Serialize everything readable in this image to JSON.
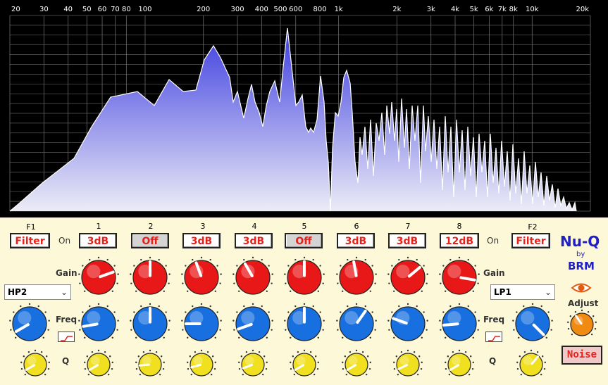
{
  "spectrum": {
    "freq_labels": [
      "20",
      "30",
      "40",
      "50",
      "60",
      "70",
      "80",
      "100",
      "200",
      "300",
      "400",
      "500",
      "600",
      "800",
      "1k",
      "2k",
      "3k",
      "4k",
      "5k",
      "6k",
      "7k",
      "8k",
      "10k",
      "20k"
    ],
    "background": "#000000",
    "fill_top": "#4b4be8",
    "fill_bottom": "#e6e6f5",
    "line": "#ffffff"
  },
  "filters": {
    "f1_label": "F1",
    "f2_label": "F2",
    "f1_button": "Filter",
    "f2_button": "Filter",
    "on_left": "On",
    "on_right": "On",
    "f1_type": "HP2",
    "f2_type": "LP1"
  },
  "bands": [
    {
      "number": "1",
      "button": "3dB",
      "off": false
    },
    {
      "number": "2",
      "button": "Off",
      "off": true
    },
    {
      "number": "3",
      "button": "3dB",
      "off": false
    },
    {
      "number": "4",
      "button": "3dB",
      "off": false
    },
    {
      "number": "5",
      "button": "Off",
      "off": true
    },
    {
      "number": "6",
      "button": "3dB",
      "off": false
    },
    {
      "number": "7",
      "button": "3dB",
      "off": false
    },
    {
      "number": "8",
      "button": "12dB",
      "off": false
    }
  ],
  "labels": {
    "gain_left": "Gain",
    "gain_right": "Gain",
    "freq_left": "Freq",
    "freq_right": "Freq",
    "q_left": "Q",
    "q_right": "Q"
  },
  "brand": {
    "title": "Nu-Q",
    "by": "by",
    "maker": "BRM",
    "adjust": "Adjust",
    "noise": "Noise"
  },
  "colors": {
    "gain_knob": "#e81818",
    "freq_knob": "#1870e0",
    "q_knob": "#f0e020",
    "adjust_knob": "#f08a10",
    "button_text": "#e8201a",
    "brand": "#2020c8"
  }
}
